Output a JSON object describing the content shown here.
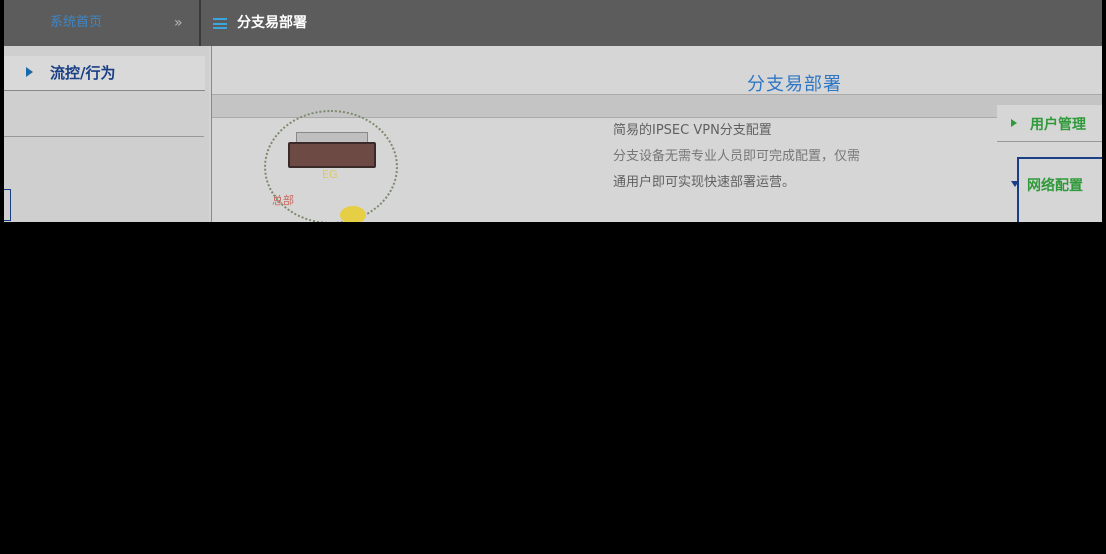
{
  "topbar": {
    "home_label": "系统首页",
    "chevron": "»",
    "page_title": "分支易部署"
  },
  "left_menu": {
    "items": [
      {
        "label": "流控/行为"
      }
    ]
  },
  "main": {
    "headline": "分支易部署",
    "illustration": {
      "device_label": "EG",
      "branch_label": "总部"
    },
    "description": [
      "简易的IPSEC VPN分支配置",
      "分支设备无需专业人员即可完成配置，仅需",
      "通用户即可实现快速部署运营。"
    ]
  },
  "right_menu": {
    "items": [
      {
        "label": "用户管理"
      },
      {
        "label": "网络配置"
      }
    ]
  },
  "colors": {
    "accent_blue": "#2e77c5",
    "menu_green": "#2f9a3a",
    "navy": "#1a3f86",
    "topbar_bg": "#5c5c5c"
  }
}
